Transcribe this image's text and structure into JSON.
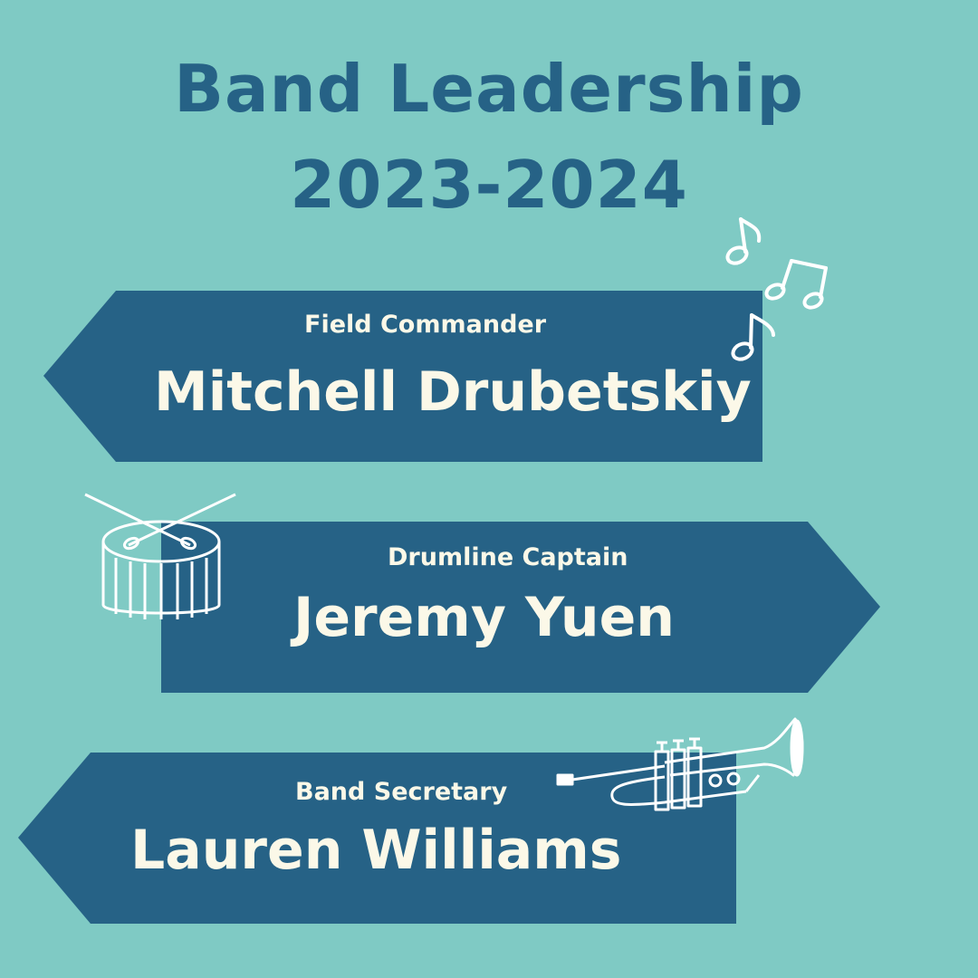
{
  "header": {
    "title_line1": "Band Leadership",
    "title_line2": "2023-2024"
  },
  "signs": [
    {
      "direction": "left",
      "role": "Field Commander",
      "name": "Mitchell Drubetskiy",
      "icon": "music-notes-icon"
    },
    {
      "direction": "right",
      "role": "Drumline Captain",
      "name": "Jeremy Yuen",
      "icon": "drum-icon"
    },
    {
      "direction": "left",
      "role": "Band Secretary",
      "name": "Lauren Williams",
      "icon": "trumpet-icon"
    }
  ],
  "colors": {
    "background": "#7fcac4",
    "sign": "#266286",
    "title": "#266286",
    "text": "#fbf8e8"
  }
}
